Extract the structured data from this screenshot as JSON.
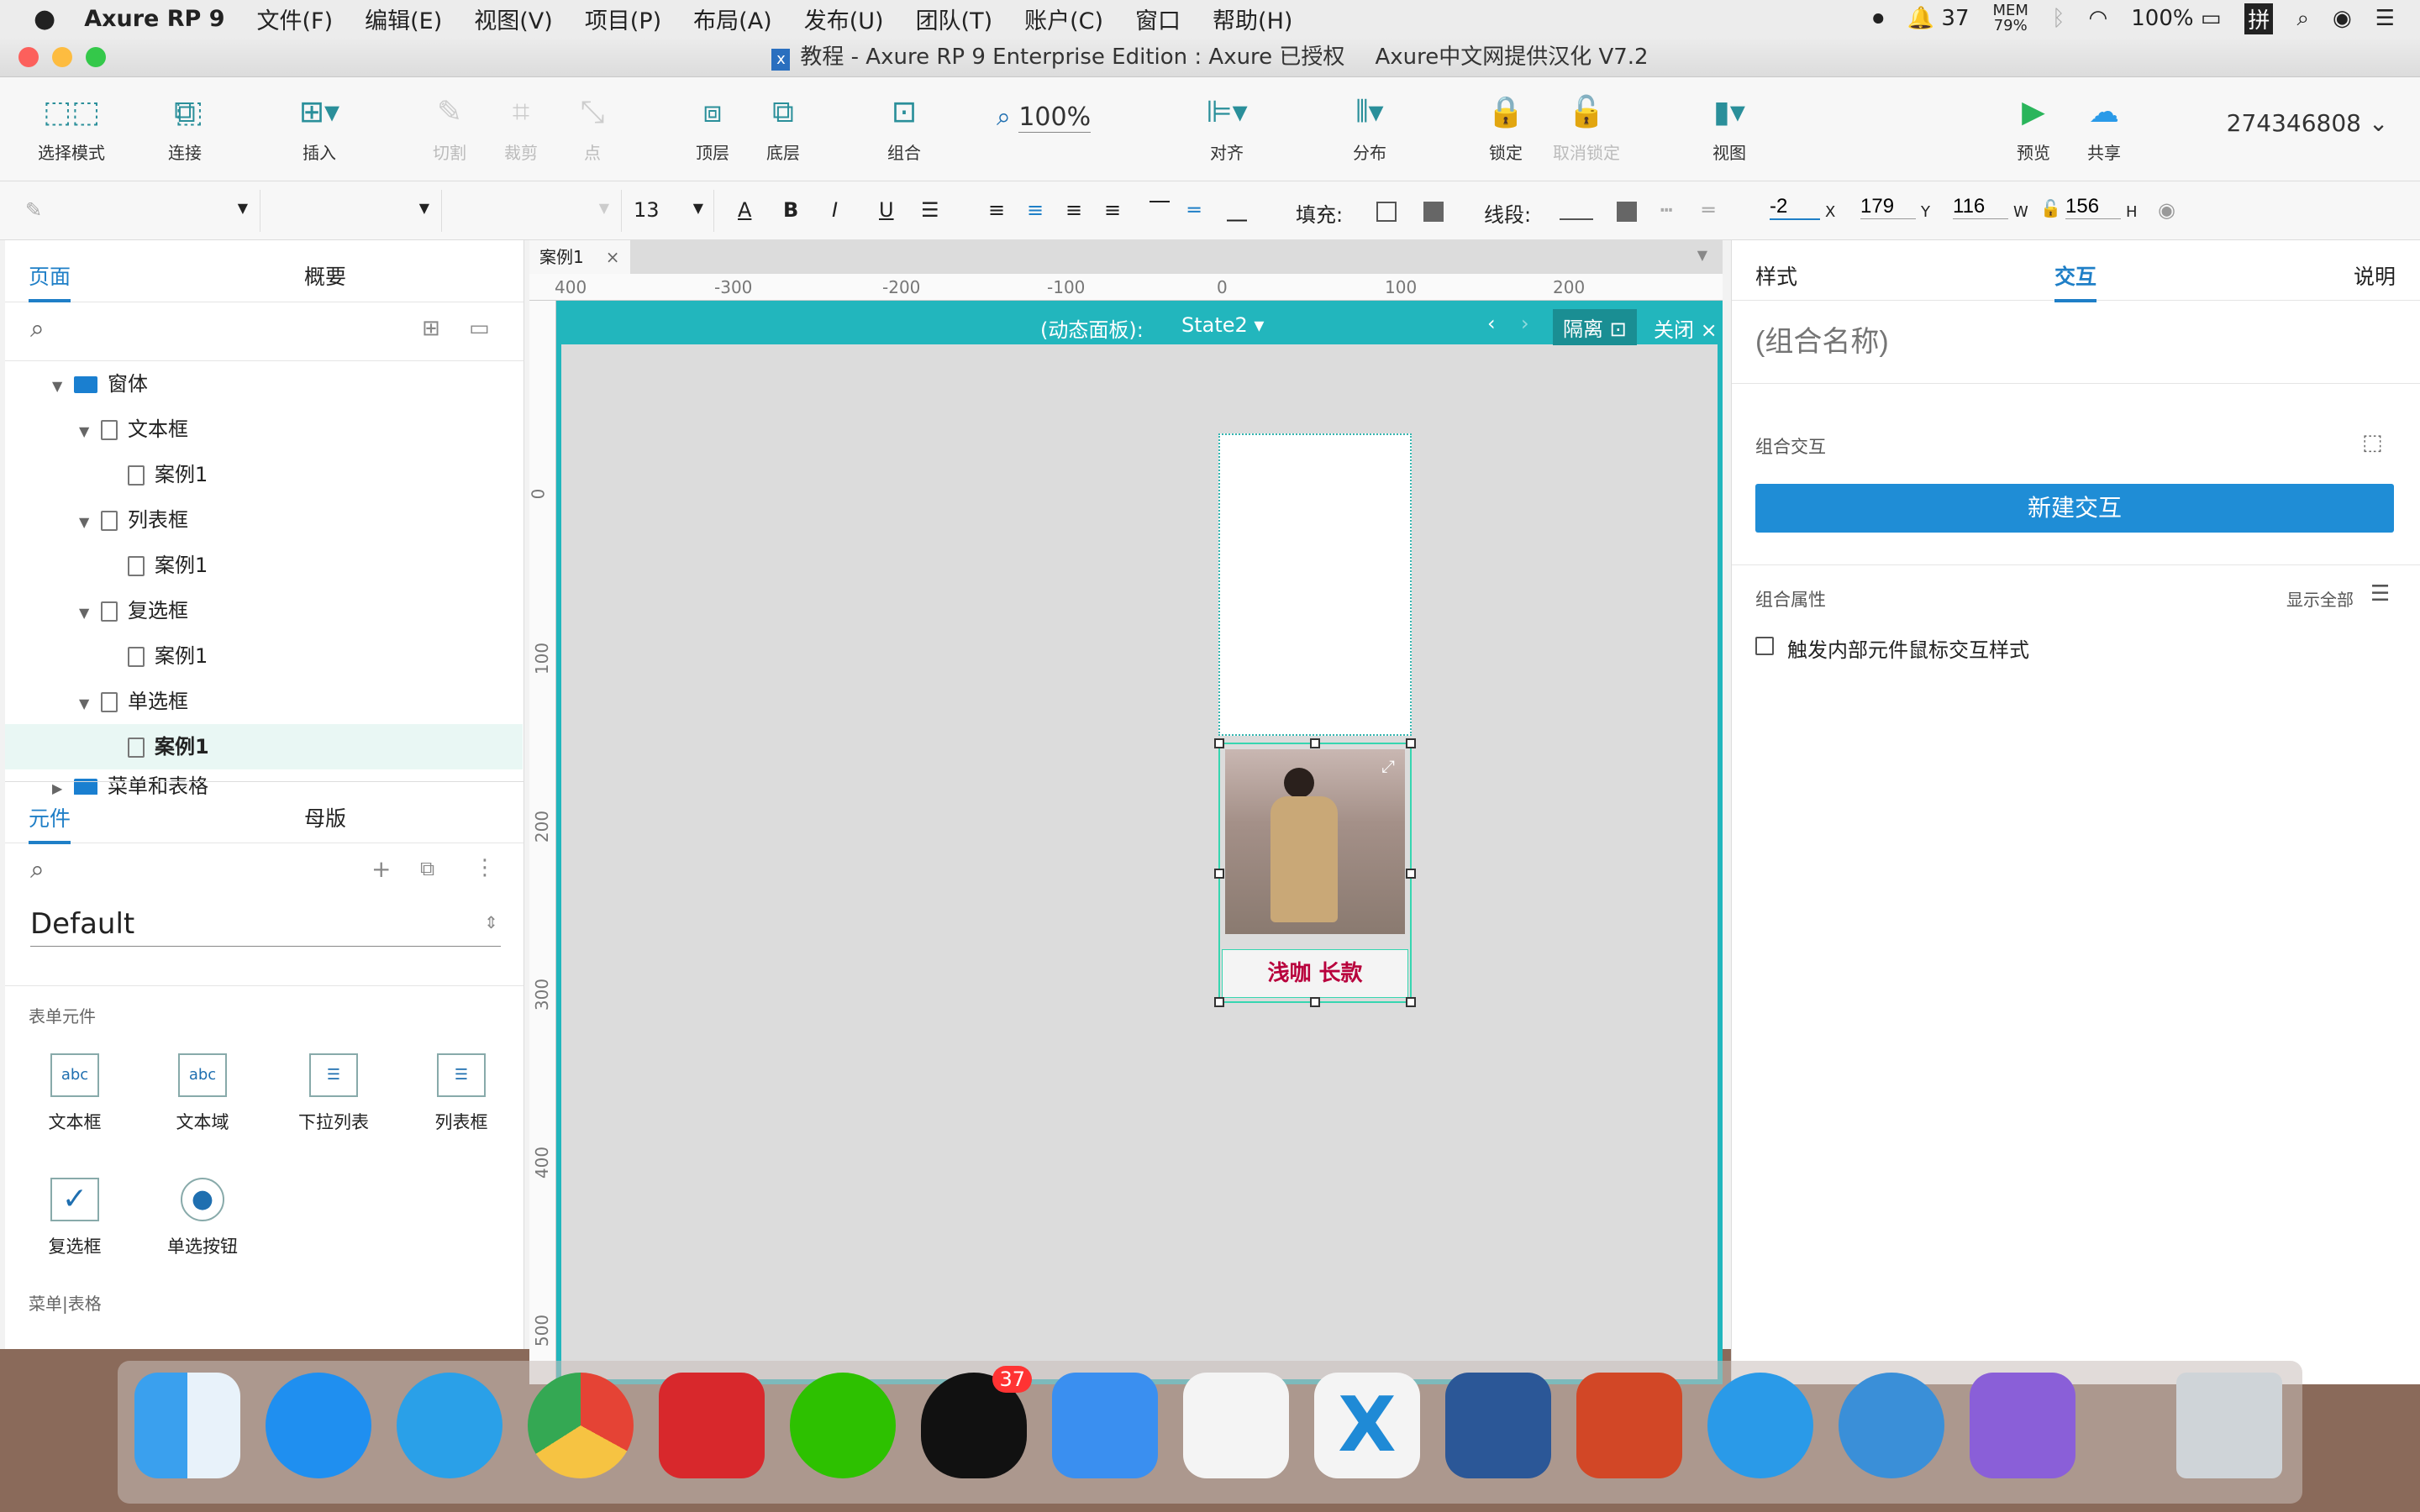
{
  "menubar": {
    "app": "Axure RP 9",
    "items": [
      "文件(F)",
      "编辑(E)",
      "视图(V)",
      "项目(P)",
      "布局(A)",
      "发布(U)",
      "团队(T)",
      "账户(C)",
      "窗口",
      "帮助(H)"
    ],
    "status": {
      "qq_count": "37",
      "mem_label": "MEM",
      "mem_value": "79%",
      "battery": "100%",
      "ime": "拼"
    }
  },
  "window": {
    "title": "教程 - Axure RP 9 Enterprise Edition : Axure 已授权",
    "localization": "Axure中文网提供汉化 V7.2"
  },
  "toolbar": {
    "select_mode": "选择模式",
    "connect": "连接",
    "insert": "插入",
    "cut": "切割",
    "crop": "裁剪",
    "point": "点",
    "top": "顶层",
    "bottom": "底层",
    "group": "组合",
    "zoom": "100%",
    "align": "对齐",
    "distribute": "分布",
    "lock": "锁定",
    "unlock": "取消锁定",
    "view": "视图",
    "preview": "预览",
    "share": "共享",
    "account": "274346808"
  },
  "format": {
    "font_size": "13",
    "fill_label": "填充:",
    "line_label": "线段:",
    "x_value": "-2",
    "x_label": "X",
    "y_value": "179",
    "y_label": "Y",
    "w_value": "116",
    "w_label": "W",
    "h_value": "156",
    "h_label": "H"
  },
  "left": {
    "tab_pages": "页面",
    "tab_outline": "概要",
    "tree": [
      {
        "label": "窗体",
        "level": 0,
        "type": "folder"
      },
      {
        "label": "文本框",
        "level": 1,
        "type": "page"
      },
      {
        "label": "案例1",
        "level": 2,
        "type": "page"
      },
      {
        "label": "列表框",
        "level": 1,
        "type": "page"
      },
      {
        "label": "案例1",
        "level": 2,
        "type": "page"
      },
      {
        "label": "复选框",
        "level": 1,
        "type": "page"
      },
      {
        "label": "案例1",
        "level": 2,
        "type": "page"
      },
      {
        "label": "单选框",
        "level": 1,
        "type": "page"
      },
      {
        "label": "案例1",
        "level": 2,
        "type": "page",
        "selected": true
      },
      {
        "label": "菜单和表格",
        "level": 0,
        "type": "folder"
      }
    ],
    "tab_widgets": "元件",
    "tab_masters": "母版",
    "library": "Default",
    "section_form": "表单元件",
    "widgets": [
      "文本框",
      "文本域",
      "下拉列表",
      "列表框",
      "复选框",
      "单选按钮"
    ],
    "section_menu": "菜单|表格"
  },
  "canvas": {
    "doc_tab": "案例1",
    "ruler_h": [
      "400",
      "-300",
      "-200",
      "-100",
      "0",
      "100",
      "200"
    ],
    "ruler_v": [
      "0",
      "100",
      "200",
      "300",
      "400",
      "500"
    ],
    "panel_label": "(动态面板):",
    "state": "State2",
    "isolate": "隔离",
    "close": "关闭",
    "product_caption": "浅咖 长款"
  },
  "right": {
    "tab_style": "样式",
    "tab_interact": "交互",
    "tab_notes": "说明",
    "group_name_placeholder": "(组合名称)",
    "group_interactions": "组合交互",
    "new_interaction": "新建交互",
    "group_props": "组合属性",
    "show_all": "显示全部",
    "checkbox_label": "触发内部元件鼠标交互样式"
  },
  "dock": {
    "qq_badge": "37"
  }
}
